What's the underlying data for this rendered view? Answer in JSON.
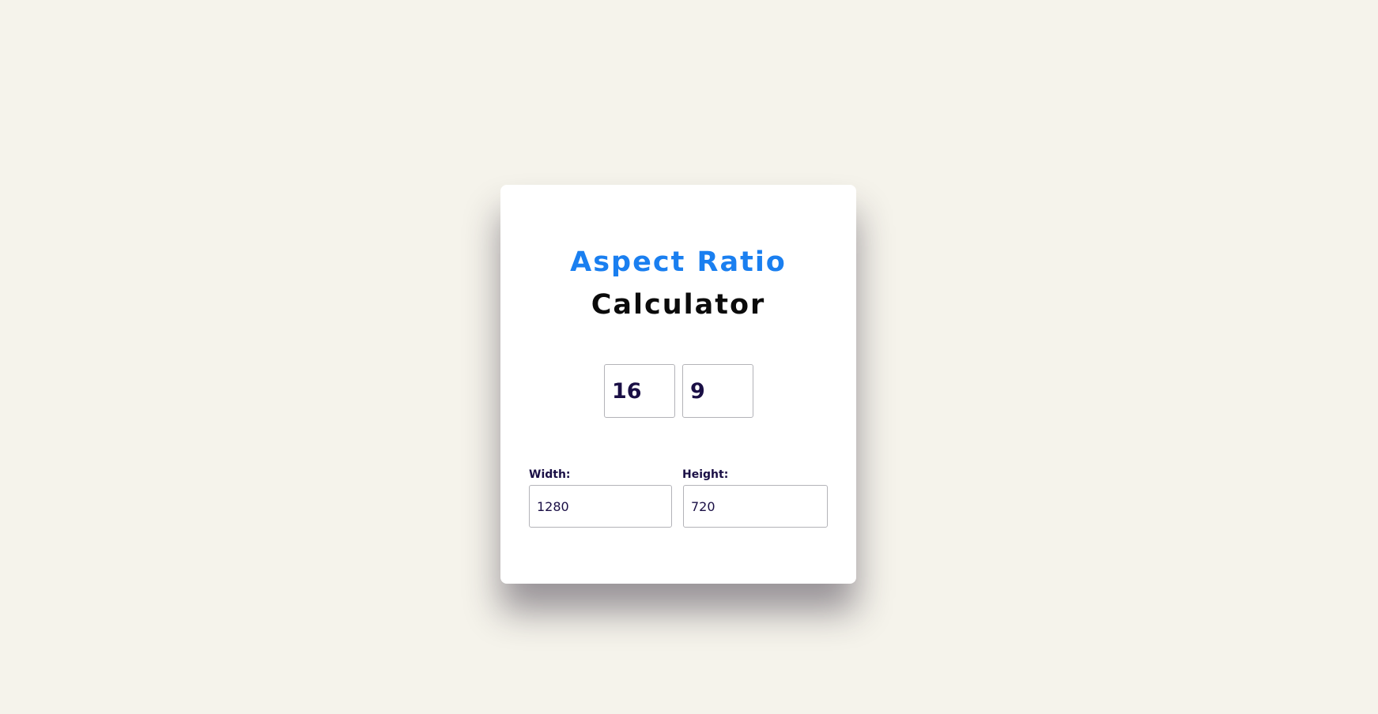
{
  "calculator": {
    "title_line1": "Aspect Ratio",
    "title_line2": "Calculator",
    "ratio": {
      "width_value": "16",
      "height_value": "9"
    },
    "dimensions": {
      "width_label": "Width:",
      "width_value": "1280",
      "height_label": "Height:",
      "height_value": "720"
    }
  },
  "colors": {
    "background": "#f5f3eb",
    "card": "#ffffff",
    "title_accent": "#1a7ff0",
    "title_dark": "#0b0b0b",
    "input_text": "#1a0f45"
  }
}
